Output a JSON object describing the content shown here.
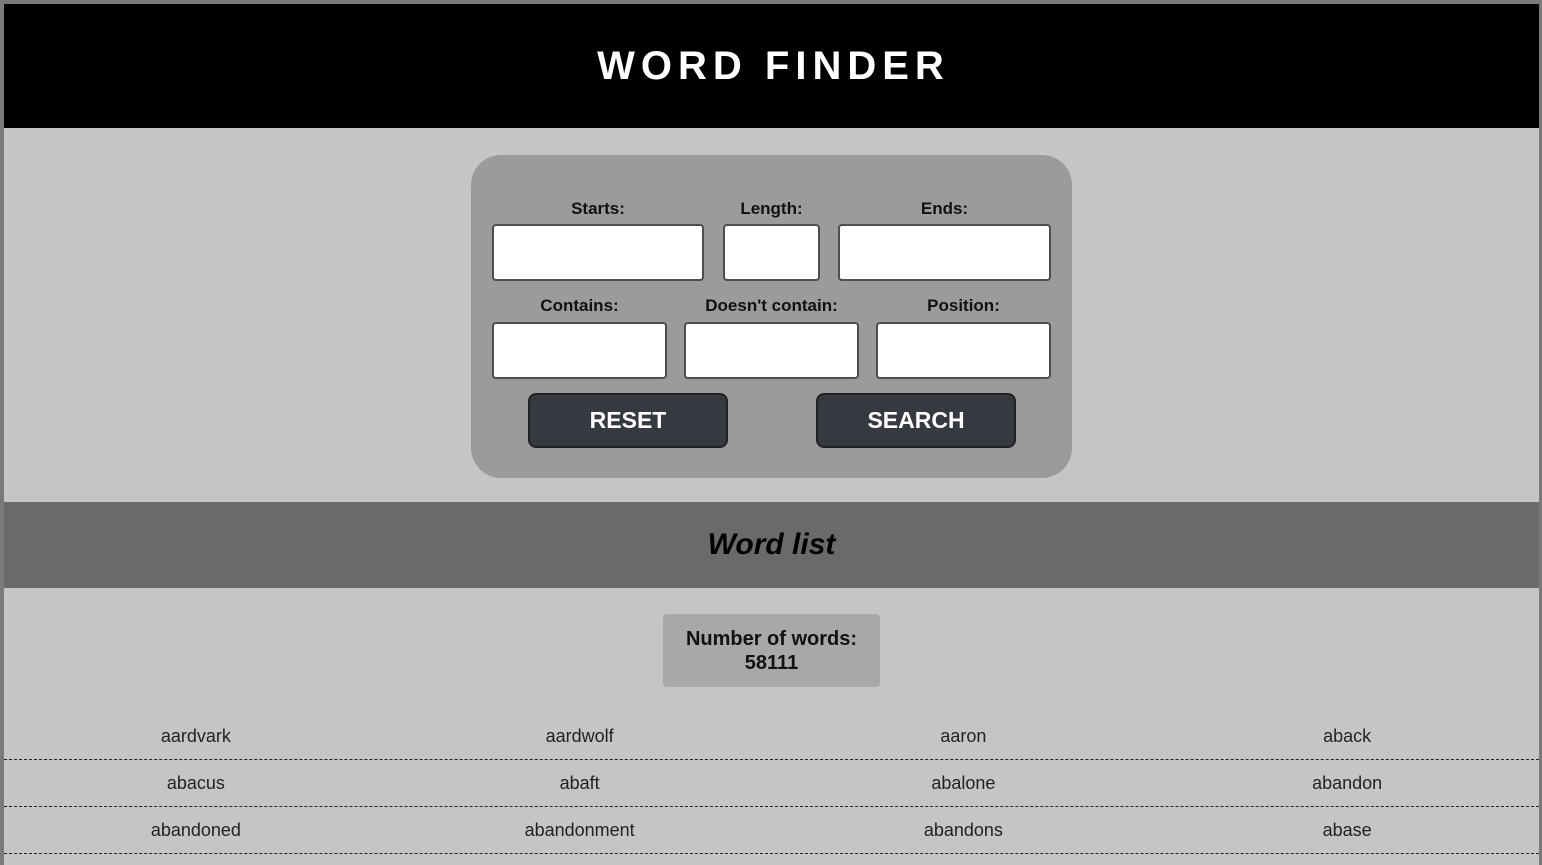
{
  "header": {
    "title": "WORD FINDER"
  },
  "form": {
    "starts_label": "Starts:",
    "length_label": "Length:",
    "ends_label": "Ends:",
    "contains_label": "Contains:",
    "doesnt_contain_label": "Doesn't contain:",
    "position_label": "Position:",
    "starts_value": "",
    "length_value": "",
    "ends_value": "",
    "contains_value": "",
    "doesnt_contain_value": "",
    "position_value": "",
    "reset_label": "RESET",
    "search_label": "SEARCH"
  },
  "wordlist": {
    "title": "Word list",
    "count_label": "Number of words:",
    "count_value": "58111",
    "rows": [
      [
        "aardvark",
        "aardwolf",
        "aaron",
        "aback"
      ],
      [
        "abacus",
        "abaft",
        "abalone",
        "abandon"
      ],
      [
        "abandoned",
        "abandonment",
        "abandons",
        "abase"
      ]
    ]
  }
}
